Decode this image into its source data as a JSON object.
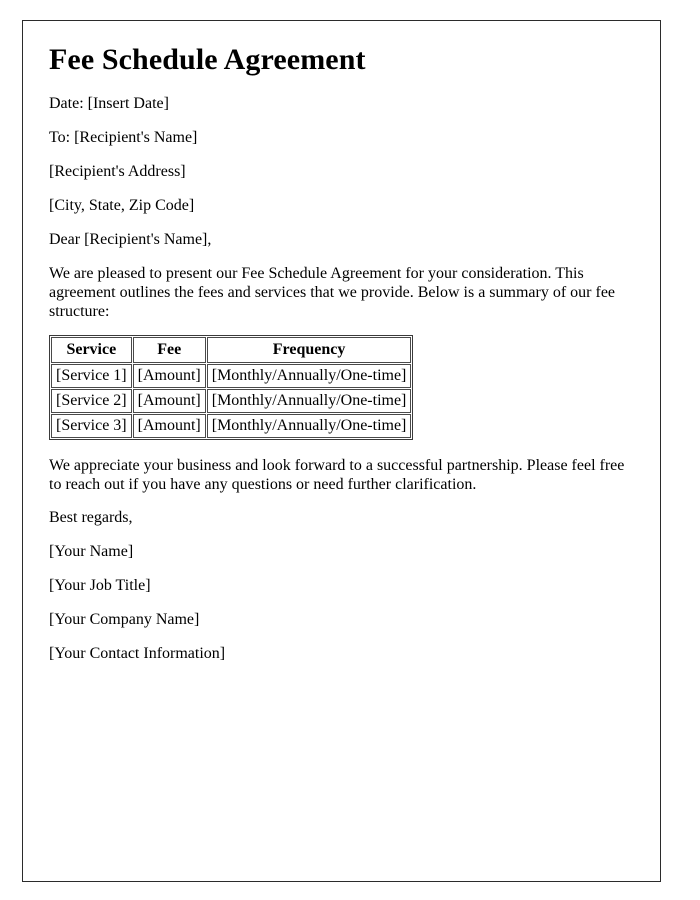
{
  "document": {
    "title": "Fee Schedule Agreement",
    "header_lines": [
      {
        "id": "date",
        "text": "Date: [Insert Date]"
      },
      {
        "id": "recipient-name",
        "text": "To: [Recipient's Name]"
      },
      {
        "id": "recipient-address",
        "text": "[Recipient's Address]"
      },
      {
        "id": "recipient-city-state-zip",
        "text": "[City, State, Zip Code]"
      },
      {
        "id": "salutation",
        "text": "Dear [Recipient's Name],"
      }
    ],
    "intro_paragraph": "We are pleased to present our Fee Schedule Agreement for your consideration. This agreement outlines the fees and services that we provide. Below is a summary of our fee structure:",
    "fee_table": {
      "columns": [
        "Service",
        "Fee",
        "Frequency"
      ],
      "rows": [
        [
          "[Service 1]",
          "[Amount]",
          "[Monthly/Annually/One-time]"
        ],
        [
          "[Service 2]",
          "[Amount]",
          "[Monthly/Annually/One-time]"
        ],
        [
          "[Service 3]",
          "[Amount]",
          "[Monthly/Annually/One-time]"
        ]
      ]
    },
    "closing_paragraph": "We appreciate your business and look forward to a successful partnership. Please feel free to reach out if you have any questions or need further clarification.",
    "signature_lines": [
      {
        "id": "valediction",
        "text": "Best regards,"
      },
      {
        "id": "your-name",
        "text": "[Your Name]"
      },
      {
        "id": "your-job-title",
        "text": "[Your Job Title]"
      },
      {
        "id": "your-company-name",
        "text": "[Your Company Name]"
      },
      {
        "id": "your-contact-information",
        "text": "[Your Contact Information]"
      }
    ]
  },
  "style": {
    "text_color": "#000000",
    "page_background": "#ffffff",
    "page_border_color": "#2b2b2b",
    "table_border_color": "#4a4a4a"
  }
}
